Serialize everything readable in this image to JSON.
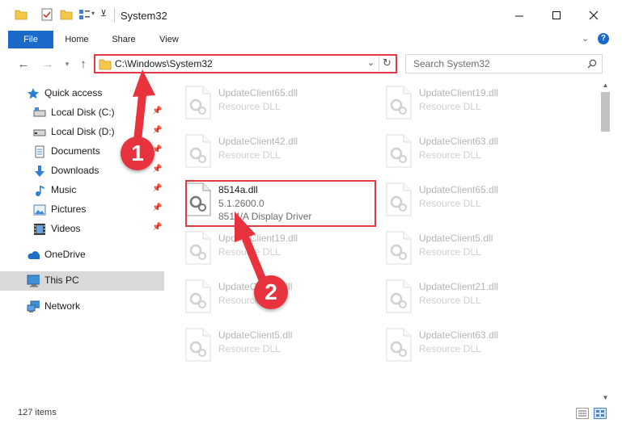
{
  "window": {
    "title": "System32"
  },
  "ribbon": {
    "tabs": [
      "File",
      "Home",
      "Share",
      "View"
    ]
  },
  "address": {
    "path": "C:\\Windows\\System32"
  },
  "search": {
    "placeholder": "Search System32"
  },
  "nav": {
    "quick_access": "Quick access",
    "items": [
      {
        "label": "Local Disk (C:)",
        "icon": "drive-icon",
        "pinned": true
      },
      {
        "label": "Local Disk (D:)",
        "icon": "drive-icon",
        "pinned": true
      },
      {
        "label": "Documents",
        "icon": "documents-icon",
        "pinned": true
      },
      {
        "label": "Downloads",
        "icon": "downloads-icon",
        "pinned": true
      },
      {
        "label": "Music",
        "icon": "music-icon",
        "pinned": true
      },
      {
        "label": "Pictures",
        "icon": "pictures-icon",
        "pinned": true
      },
      {
        "label": "Videos",
        "icon": "videos-icon",
        "pinned": true
      }
    ],
    "onedrive": "OneDrive",
    "this_pc": "This PC",
    "network": "Network"
  },
  "files": {
    "left": [
      {
        "name": "UpdateClient65.dll",
        "type": "Resource DLL"
      },
      {
        "name": "UpdateClient42.dll",
        "type": "Resource DLL"
      },
      {
        "name": "8514a.dll",
        "version": "5.1.2600.0",
        "description": "8514/A Display Driver"
      },
      {
        "name": "UpdateClient19.dll",
        "type": "Resource DLL"
      },
      {
        "name": "UpdateClient5.dll",
        "type": "Resource DLL"
      },
      {
        "name": "UpdateClient5.dll",
        "type": "Resource DLL"
      }
    ],
    "right": [
      {
        "name": "UpdateClient19.dll",
        "type": "Resource DLL"
      },
      {
        "name": "UpdateClient63.dll",
        "type": "Resource DLL"
      },
      {
        "name": "UpdateClient65.dll",
        "type": "Resource DLL"
      },
      {
        "name": "UpdateClient5.dll",
        "type": "Resource DLL"
      },
      {
        "name": "UpdateClient21.dll",
        "type": "Resource DLL"
      },
      {
        "name": "UpdateClient63.dll",
        "type": "Resource DLL"
      }
    ]
  },
  "status": {
    "count": "127 items"
  },
  "annotations": {
    "step1": "1",
    "step2": "2"
  },
  "colors": {
    "accent": "#1b6ac9",
    "annotation": "#e8323d",
    "selection": "#d9d9d9"
  }
}
